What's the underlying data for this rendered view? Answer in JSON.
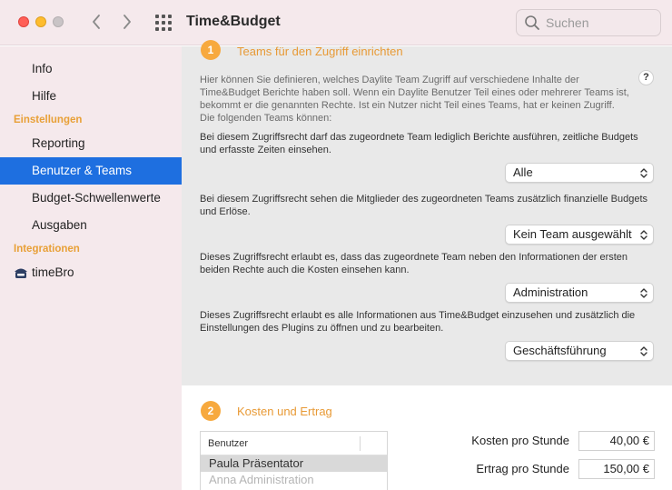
{
  "window": {
    "title": "Time&Budget"
  },
  "search": {
    "placeholder": "Suchen"
  },
  "sidebar": {
    "items": [
      {
        "label": "Info"
      },
      {
        "label": "Hilfe"
      }
    ],
    "sections": [
      {
        "title": "Einstellungen",
        "items": [
          {
            "label": "Reporting"
          },
          {
            "label": "Benutzer & Teams",
            "active": true
          },
          {
            "label": "Budget-Schwellenwerte"
          },
          {
            "label": "Ausgaben"
          }
        ]
      },
      {
        "title": "Integrationen",
        "items": [
          {
            "label": "timeBro",
            "icon": "timebro-icon"
          }
        ]
      }
    ]
  },
  "section1": {
    "number": "1",
    "title": "Teams für den Zugriff einrichten",
    "help_label": "?",
    "intro": "Hier können Sie definieren, welches Daylite Team Zugriff auf verschiedene Inhalte der Time&Budget Berichte haben soll. Wenn ein Daylite Benutzer Teil eines oder mehrerer Teams ist, bekommt er die genannten Rechte. Ist ein Nutzer nicht Teil eines Teams, hat er keinen Zugriff. Die folgenden Teams können:",
    "rights": [
      {
        "text": "Bei diesem Zugriffsrecht darf das zugeordnete Team lediglich Berichte ausführen, zeitliche Budgets und erfasste Zeiten einsehen.",
        "value": "Alle"
      },
      {
        "text": "Bei diesem Zugriffsrecht sehen die Mitglieder des zugeordneten Teams zusätzlich finanzielle Budgets und Erlöse.",
        "value": "Kein Team ausgewählt"
      },
      {
        "text": "Dieses Zugriffsrecht erlaubt es, dass das zugeordnete Team neben den Informationen der ersten beiden Rechte auch die Kosten einsehen kann.",
        "value": "Administration"
      },
      {
        "text": "Dieses Zugriffsrecht erlaubt es alle Informationen aus Time&Budget einzusehen und zusätzlich die Einstellungen des Plugins zu öffnen und zu bearbeiten.",
        "value": "Geschäftsführung"
      }
    ]
  },
  "section2": {
    "number": "2",
    "title": "Kosten und Ertrag",
    "table": {
      "header": "Benutzer",
      "rows": [
        {
          "name": "Paula Präsentator",
          "selected": true
        },
        {
          "name": "Anna Administration",
          "selected": false
        }
      ]
    },
    "cost_label": "Kosten pro Stunde",
    "cost_value": "40,00 €",
    "revenue_label": "Ertrag pro Stunde",
    "revenue_value": "150,00 €"
  },
  "colors": {
    "accent": "#1e6fe0",
    "section_orange": "#e8a037",
    "sidebar_bg": "#f5e9ec"
  }
}
